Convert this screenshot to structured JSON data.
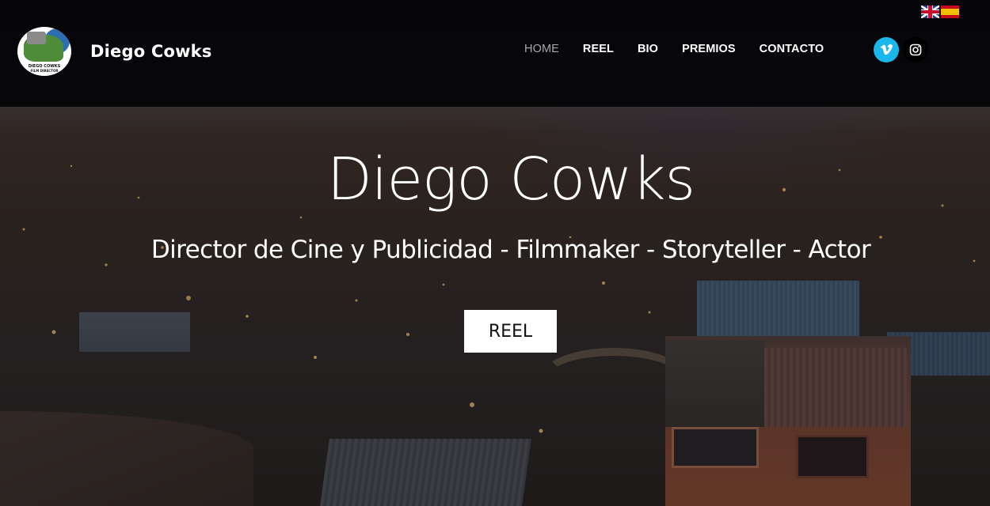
{
  "header": {
    "brand_name": "Diego Cowks",
    "logo_text_line1": "DIEGO COWKS",
    "logo_text_line2": "FILM DIRECTOR",
    "languages": [
      {
        "icon": "flag-uk-icon",
        "code": "en"
      },
      {
        "icon": "flag-es-icon",
        "code": "es"
      }
    ],
    "nav": [
      {
        "label": "HOME",
        "active": true
      },
      {
        "label": "REEL",
        "active": false
      },
      {
        "label": "BIO",
        "active": false
      },
      {
        "label": "PREMIOS",
        "active": false
      },
      {
        "label": "CONTACTO",
        "active": false
      }
    ],
    "social": [
      {
        "icon": "vimeo-icon",
        "color": "#1ab7ea"
      },
      {
        "icon": "instagram-icon",
        "color": "#000000"
      }
    ]
  },
  "hero": {
    "title": "Diego Cowks",
    "subtitle": "Director de Cine y Publicidad - Filmmaker - Storyteller - Actor",
    "cta_label": "REEL"
  },
  "colors": {
    "header_bg": "#030306",
    "nav_active": "#a8a8a8",
    "nav_text": "#ffffff",
    "vimeo": "#1ab7ea",
    "cta_bg": "#ffffff"
  }
}
